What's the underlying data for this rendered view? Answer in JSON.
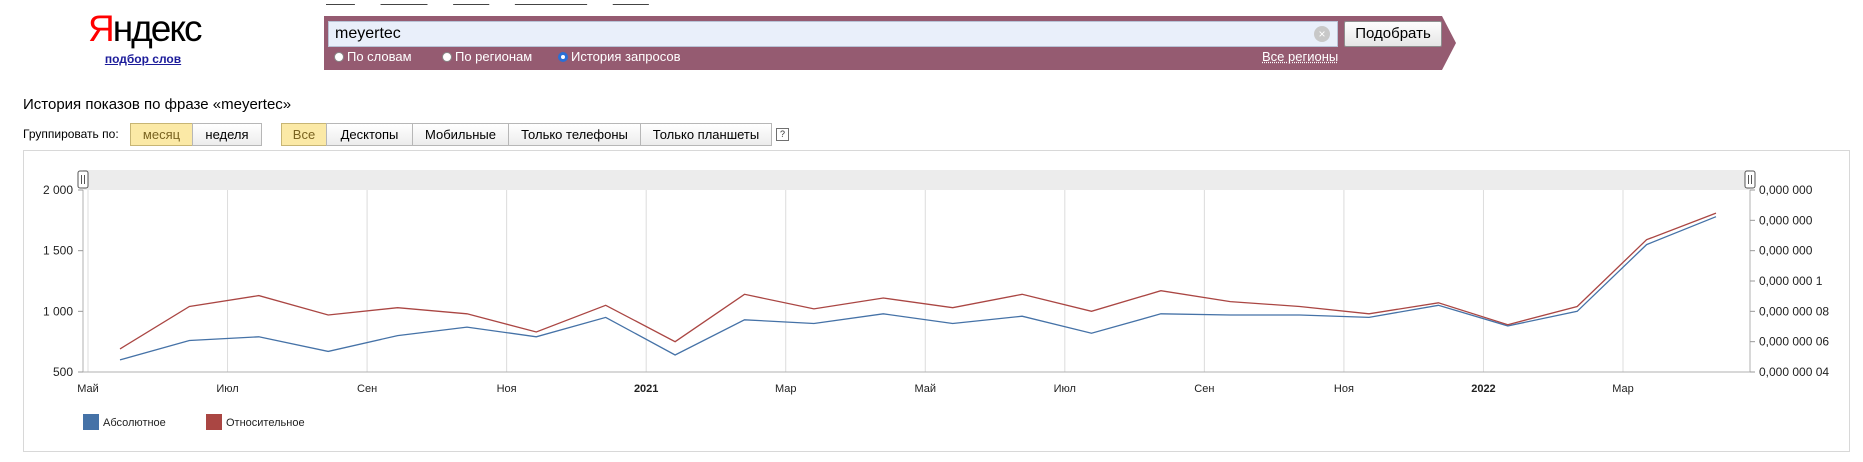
{
  "logo": {
    "text_first": "Я",
    "text_rest": "ндекс",
    "subtitle": "подбор слов"
  },
  "search": {
    "query": "meyertec",
    "submit_label": "Подобрать",
    "clear_symbol": "×",
    "modes": [
      {
        "label": "По словам",
        "selected": false
      },
      {
        "label": "По регионам",
        "selected": false
      },
      {
        "label": "История запросов",
        "selected": true
      }
    ],
    "regions_link": "Все регионы"
  },
  "heading": "История показов по фразе «meyertec»",
  "grouping": {
    "label": "Группировать по:",
    "options": [
      {
        "label": "месяц",
        "selected": true
      },
      {
        "label": "неделя",
        "selected": false
      }
    ]
  },
  "device_filter": {
    "options": [
      {
        "label": "Все",
        "selected": true
      },
      {
        "label": "Десктопы",
        "selected": false
      },
      {
        "label": "Мобильные",
        "selected": false
      },
      {
        "label": "Только телефоны",
        "selected": false
      },
      {
        "label": "Только планшеты",
        "selected": false
      }
    ],
    "help_label": "?"
  },
  "chart_data": {
    "type": "line",
    "x_labels": [
      "Май",
      "Июл",
      "Сен",
      "Ноя",
      "2021",
      "Мар",
      "Май",
      "Июл",
      "Сен",
      "Ноя",
      "2022",
      "Мар"
    ],
    "x_labels_bold": [
      "2021",
      "2022"
    ],
    "y_left_ticks": [
      "2 000",
      "1 500",
      "1 000",
      "500"
    ],
    "y_left_range": [
      500,
      2000
    ],
    "y_right_ticks": [
      "0,000 000",
      "0,000 000",
      "0,000 000",
      "0,000 000 1",
      "0,000 000 08",
      "0,000 000 06",
      "0,000 000 04"
    ],
    "series": [
      {
        "name": "Абсолютное",
        "color": "#4572a7",
        "values": [
          600,
          760,
          790,
          670,
          800,
          870,
          790,
          950,
          640,
          930,
          900,
          980,
          900,
          960,
          820,
          980,
          970,
          970,
          950,
          1050,
          880,
          1000,
          1550,
          1780
        ]
      },
      {
        "name": "Относительное",
        "color": "#aa4643",
        "values": [
          690,
          1040,
          1130,
          970,
          1030,
          980,
          830,
          1050,
          750,
          1140,
          1020,
          1110,
          1030,
          1140,
          1000,
          1170,
          1080,
          1040,
          980,
          1070,
          890,
          1040,
          1590,
          1810
        ]
      }
    ],
    "grid": true,
    "legend_position": "bottom-left"
  }
}
